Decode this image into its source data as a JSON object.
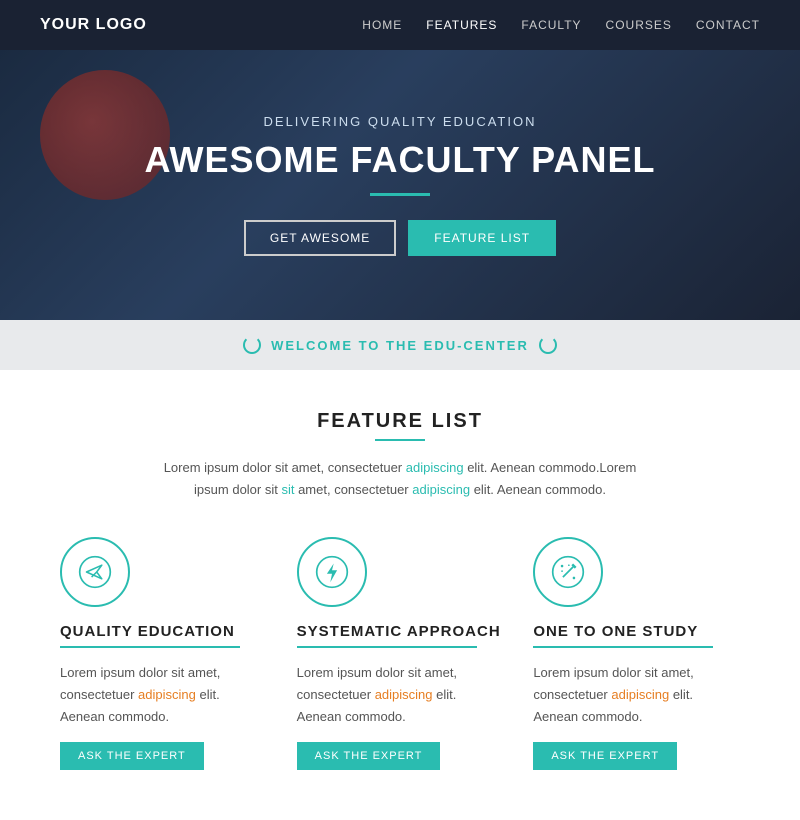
{
  "navbar": {
    "logo": "YOUR LOGO",
    "links": [
      {
        "label": "HOME",
        "active": false
      },
      {
        "label": "FEATURES",
        "active": true
      },
      {
        "label": "FACULTY",
        "active": false
      },
      {
        "label": "COURSES",
        "active": false
      },
      {
        "label": "CONTACT",
        "active": false
      }
    ]
  },
  "hero": {
    "subtitle": "DELIVERING QUALITY EDUCATION",
    "title": "AWESOME FACULTY PANEL",
    "btn_outline": "GET AWESOME",
    "btn_teal": "FEATURE LIST"
  },
  "welcome": {
    "text": "WELCOME TO THE EDU-CENTER"
  },
  "features": {
    "title": "FEATURE LIST",
    "desc_part1": "Lorem ipsum dolor sit amet, consectetuer ",
    "desc_highlight1": "adipiscing",
    "desc_part2": " elit. Aenean commodo.",
    "desc_part3": "Lorem ipsum dolor sit ",
    "desc_highlight2": "sit",
    "desc_part4": " amet, consectetuer ",
    "desc_highlight3": "adipiscing",
    "desc_part5": " elit. Aenean commodo.",
    "cards": [
      {
        "icon": "paper-plane",
        "title": "QUALITY EDUCATION",
        "desc_prefix": "Lorem ipsum dolor sit amet, consectetuer ",
        "desc_highlight": "adipiscing",
        "desc_suffix": " elit. Aenean commodo.",
        "btn": "ASK THE EXPERT"
      },
      {
        "icon": "lightning",
        "title": "SYSTEMATIC APPROACH",
        "desc_prefix": "Lorem ipsum dolor sit amet, consectetuer ",
        "desc_highlight": "adipiscing",
        "desc_suffix": " elit. Aenean commodo.",
        "btn": "ASK THE EXPERT"
      },
      {
        "icon": "wand",
        "title": "ONE TO ONE STUDY",
        "desc_prefix": "Lorem ipsum dolor sit amet, consectetuer ",
        "desc_highlight": "adipiscing",
        "desc_suffix": " elit. Aenean commodo.",
        "btn": "ASK THE EXPERT"
      }
    ]
  }
}
